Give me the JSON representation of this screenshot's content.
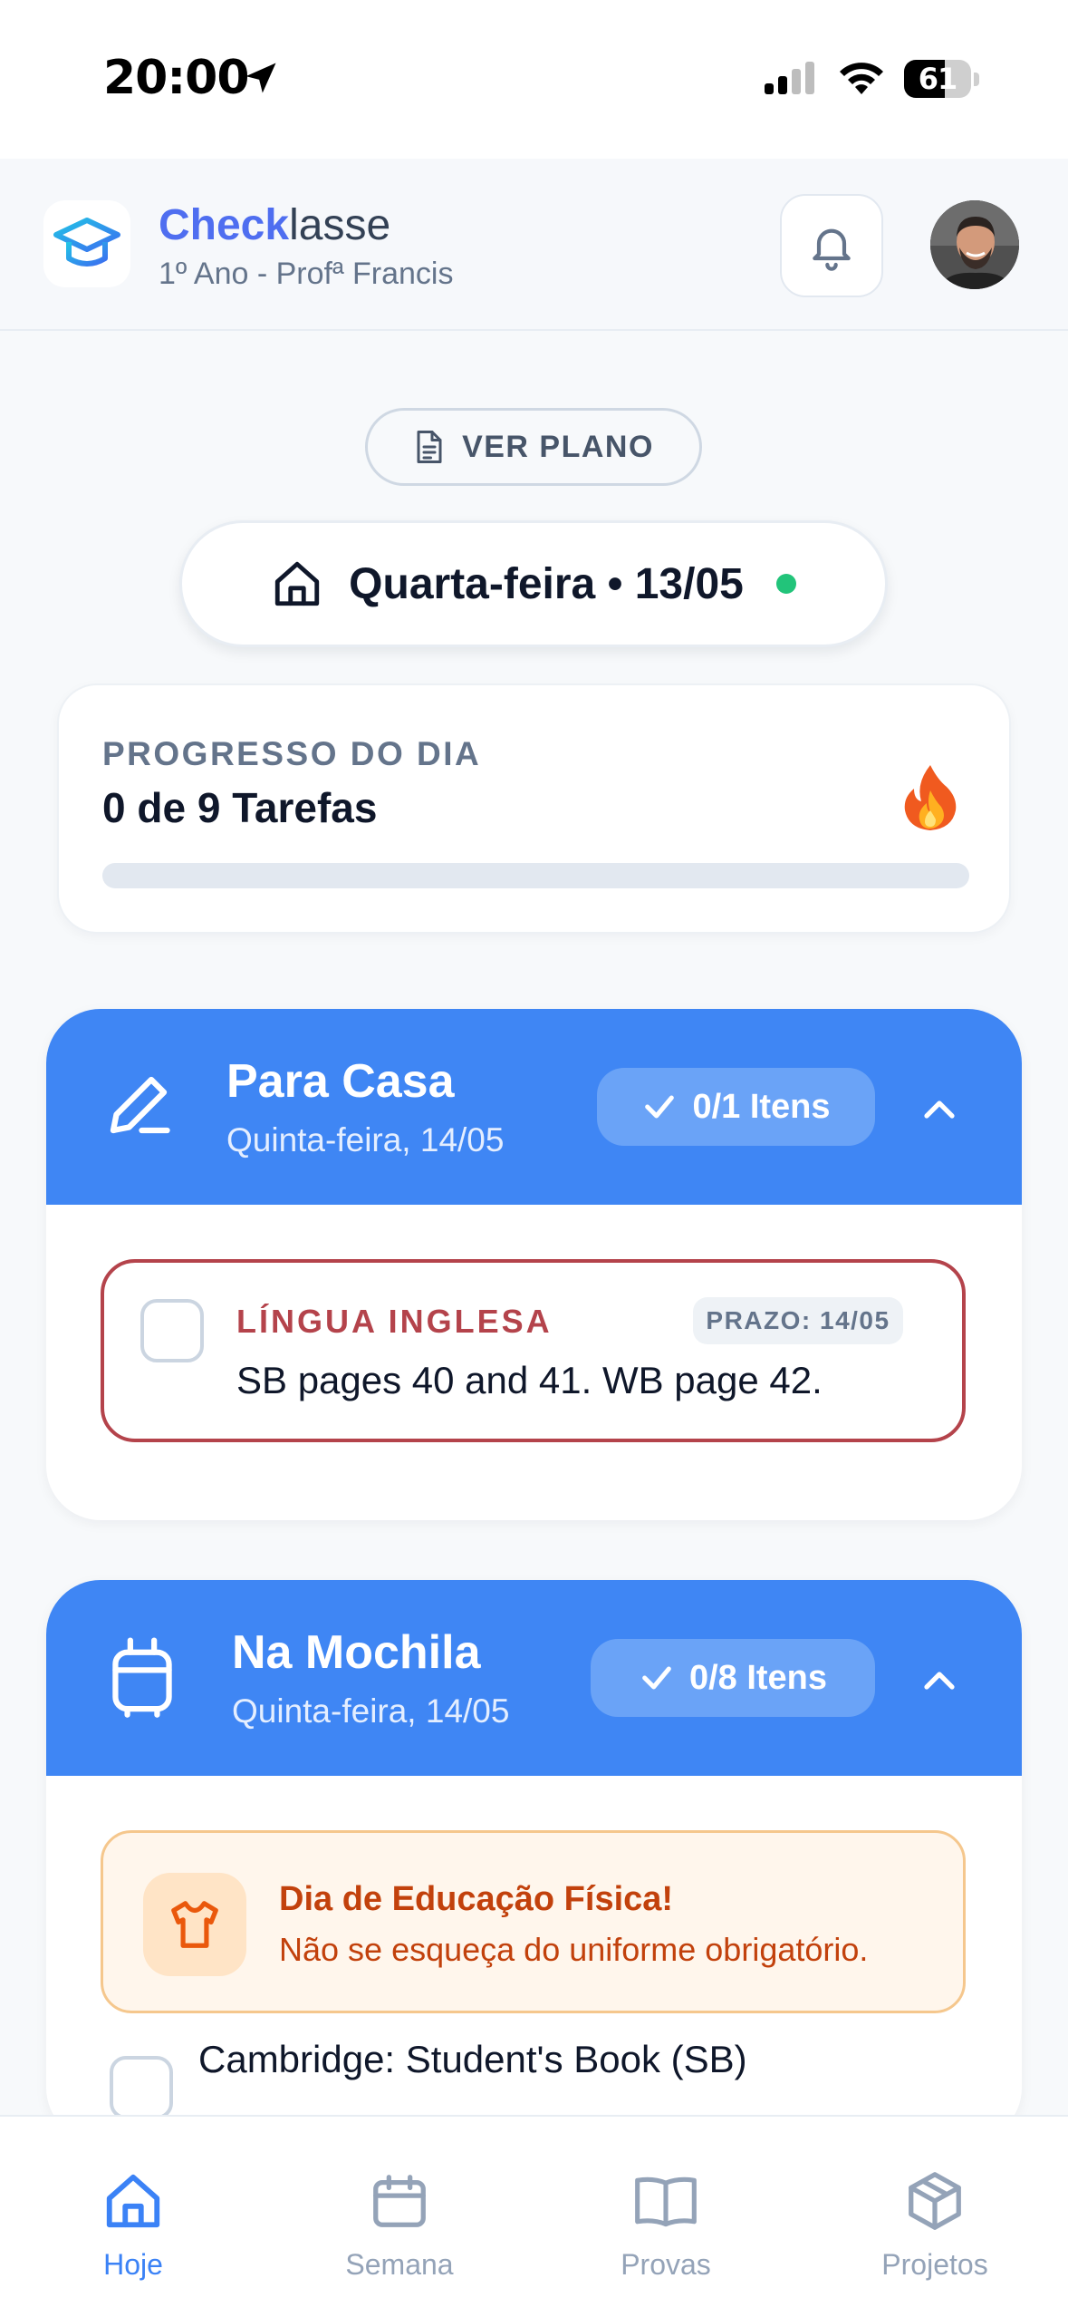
{
  "status_bar": {
    "time": "20:00",
    "battery_level": "61"
  },
  "header": {
    "brand_part1": "Check",
    "brand_part2": "lasse",
    "subtitle": "1º Ano - Profª Francis"
  },
  "ver_plano": {
    "label": "VER PLANO"
  },
  "day": {
    "label": "Quarta-feira • 13/05"
  },
  "progress": {
    "label": "PROGRESSO DO DIA",
    "count_text": "0 de 9 Tarefas",
    "completed": 0,
    "total": 9
  },
  "sections": {
    "para_casa": {
      "title": "Para Casa",
      "subtitle": "Quinta-feira, 14/05",
      "badge": "0/1 Itens",
      "tasks": [
        {
          "subject": "LÍNGUA INGLESA",
          "due": "PRAZO: 14/05",
          "text": "SB pages 40 and 41. WB page 42."
        }
      ]
    },
    "na_mochila": {
      "title": "Na Mochila",
      "subtitle": "Quinta-feira, 14/05",
      "badge": "0/8 Itens",
      "alert": {
        "title": "Dia de Educação Física!",
        "text": "Não se esqueça do uniforme obrigatório."
      },
      "items": [
        {
          "text": "Cambridge: Student's Book (SB)"
        }
      ]
    }
  },
  "bottom_nav": {
    "items": [
      {
        "label": "Hoje",
        "icon": "home-icon",
        "active": true
      },
      {
        "label": "Semana",
        "icon": "calendar-icon",
        "active": false
      },
      {
        "label": "Provas",
        "icon": "book-open-icon",
        "active": false
      },
      {
        "label": "Projetos",
        "icon": "box-icon",
        "active": false
      }
    ]
  },
  "colors": {
    "accent": "#3f86f4",
    "brand": "#4f6ef0",
    "danger": "#b4434b",
    "warning": "#c2410c",
    "success": "#22c47a"
  }
}
